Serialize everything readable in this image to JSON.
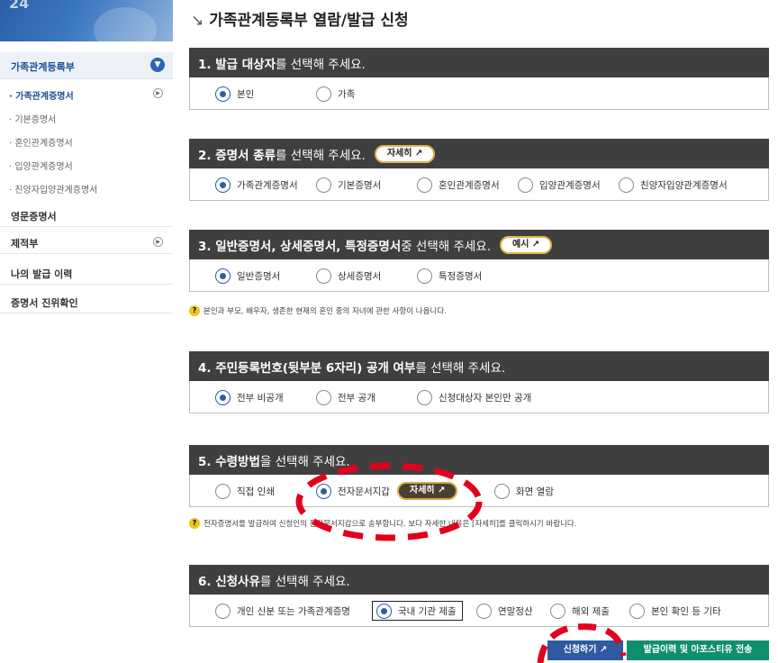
{
  "sidebar": {
    "banner_text": "24",
    "group_title": "가족관계등록부",
    "sub_items": [
      {
        "label": "· 가족관계증명서",
        "active": true
      },
      {
        "label": "· 기본증명서",
        "active": false
      },
      {
        "label": "· 혼인관계증명서",
        "active": false
      },
      {
        "label": "· 입양관계증명서",
        "active": false
      },
      {
        "label": "· 친양자입양관계증명서",
        "active": false
      }
    ],
    "main_items": [
      {
        "label": "영문증명서"
      },
      {
        "label": "제적부"
      },
      {
        "label": "나의 발급 이력"
      },
      {
        "label": "증명서 진위확인"
      }
    ]
  },
  "page": {
    "title": "가족관계등록부 열람/발급 신청",
    "title_mark": "↘"
  },
  "sections": [
    {
      "title_strong": "1. 발급 대상자",
      "title_rest": "를 선택해 주세요.",
      "options": [
        {
          "label": "본인",
          "checked": true
        },
        {
          "label": "가족",
          "checked": false
        }
      ]
    },
    {
      "title_strong": "2. 증명서 종류",
      "title_rest": "를 선택해 주세요.",
      "button": "자세히 ↗",
      "options": [
        {
          "label": "가족관계증명서",
          "checked": true
        },
        {
          "label": "기본증명서",
          "checked": false
        },
        {
          "label": "혼인관계증명서",
          "checked": false
        },
        {
          "label": "입양관계증명서",
          "checked": false
        },
        {
          "label": "친양자입양관계증명서",
          "checked": false
        }
      ]
    },
    {
      "title_strong": "3. 일반증명서, 상세증명서, 특정증명서",
      "title_rest": " 중 선택해 주세요.",
      "button": "예시 ↗",
      "options": [
        {
          "label": "일반증명서",
          "checked": true
        },
        {
          "label": "상세증명서",
          "checked": false
        },
        {
          "label": "특정증명서",
          "checked": false
        }
      ],
      "note": "본인과 부모, 배우자, 생존한 현재의 혼인 중의 자녀에 관한 사항이 나옵니다."
    },
    {
      "title_strong": "4. 주민등록번호(뒷부분 6자리) 공개 여부",
      "title_rest": "를 선택해 주세요.",
      "options": [
        {
          "label": "전부 비공개",
          "checked": true
        },
        {
          "label": "전부 공개",
          "checked": false
        },
        {
          "label": "신청대상자 본인만 공개",
          "checked": false
        }
      ]
    },
    {
      "title_strong": "5. 수령방법",
      "title_rest": "을 선택해 주세요.",
      "options": [
        {
          "label": "직접 인쇄",
          "checked": false
        },
        {
          "label": "전자문서지갑",
          "checked": true
        },
        {
          "label": "화면 열람",
          "checked": false
        }
      ],
      "inline_button": "자세히 ↗",
      "note": "전자증명서를 발급하여 신청인의 전자문서지갑으로 송부합니다. 보다 자세한 내용은 [자세히]를 클릭하시기 바랍니다."
    },
    {
      "title_strong": "6. 신청사유",
      "title_rest": "를 선택해 주세요.",
      "options": [
        {
          "label": "개인 신분 또는 가족관계증명",
          "checked": false
        },
        {
          "label": "국내 기관 제출",
          "checked": true
        },
        {
          "label": "연말정산",
          "checked": false
        },
        {
          "label": "해외 제출",
          "checked": false
        },
        {
          "label": "본인 확인 등 기타",
          "checked": false
        }
      ]
    }
  ],
  "actions": {
    "apply": "신청하기 ↗",
    "send": "발급이력 및 아포스티유 전송"
  },
  "colors": {
    "section_header": "#3f3f3f",
    "radio_checked": "#2d5ea6",
    "apply_button": "#2d5aa0",
    "send_button": "#0f8f6e",
    "annotation": "#e3001b"
  }
}
